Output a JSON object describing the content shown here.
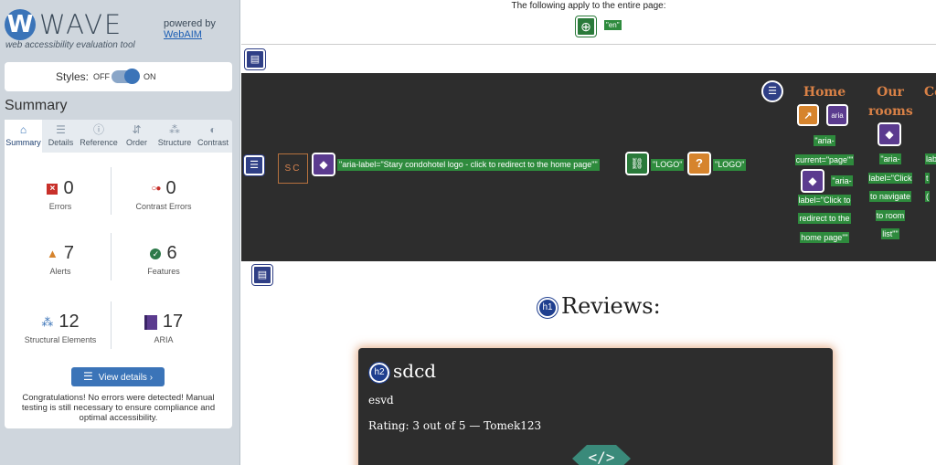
{
  "sidebar": {
    "brand": {
      "badge": "W",
      "name": "WAVE",
      "subtitle": "web accessibility evaluation tool",
      "powered_by": "powered by",
      "webaim_link": "WebAIM"
    },
    "styles": {
      "label": "Styles:",
      "off": "OFF",
      "on": "ON",
      "state": "on"
    },
    "summary_title": "Summary",
    "tabs": [
      {
        "label": "Summary",
        "icon": "home-icon",
        "glyph": "⌂",
        "active": true
      },
      {
        "label": "Details",
        "icon": "list-icon",
        "glyph": "☰",
        "active": false
      },
      {
        "label": "Reference",
        "icon": "info-icon",
        "glyph": "ⓘ",
        "active": false
      },
      {
        "label": "Order",
        "icon": "order-icon",
        "glyph": "⇵",
        "active": false
      },
      {
        "label": "Structure",
        "icon": "structure-icon",
        "glyph": "⁂",
        "active": false
      },
      {
        "label": "Contrast",
        "icon": "contrast-icon",
        "glyph": "◐",
        "active": false
      }
    ],
    "stats": [
      {
        "count": "0",
        "label": "Errors",
        "icon": "error-icon"
      },
      {
        "count": "0",
        "label": "Contrast Errors",
        "icon": "contrast-error-icon"
      },
      {
        "count": "7",
        "label": "Alerts",
        "icon": "alert-icon"
      },
      {
        "count": "6",
        "label": "Features",
        "icon": "feature-icon"
      },
      {
        "count": "12",
        "label": "Structural Elements",
        "icon": "structure-icon"
      },
      {
        "count": "17",
        "label": "ARIA",
        "icon": "aria-icon"
      }
    ],
    "view_details": "View details ›",
    "congrats": "Congratulations! No errors were detected! Manual testing is still necessary to ensure compliance and optimal accessibility."
  },
  "content": {
    "page_note": "The following apply to the entire page:",
    "lang_tag": "\"en\"",
    "header": {
      "logo_text": "SC",
      "logo_aria": "\"aria-label=\"Stary condohotel logo - click to redirect to the home page\"\"",
      "link_tag": "\"LOGO\"",
      "alert_tag": "\"LOGO\"",
      "nav_home": "Home",
      "nav_rooms_1": "Our",
      "nav_rooms_2": "rooms",
      "nav_partial": "Co",
      "aria_label": "aria",
      "home_current": [
        "\"aria-",
        "current=\"page\"\""
      ],
      "home_label": [
        "\"aria-",
        "label=\"Click to",
        "redirect to the",
        "home page\"\""
      ],
      "rooms_label": [
        "\"aria-",
        "label=\"Click",
        "to navigate",
        "to room",
        "list\"\""
      ],
      "partial_tags": [
        "lab",
        "t",
        "("
      ]
    },
    "reviews_heading": "Reviews:",
    "h1_badge": "h1",
    "card": {
      "h2_badge": "h2",
      "title": "sdcd",
      "body": "esvd",
      "rating": "Rating: 3 out of 5 — Tomek123",
      "code_glyph": "</>"
    }
  },
  "colors": {
    "wave_blue": "#3b74b8",
    "feature_green": "#2e8b3d",
    "alert_orange": "#d6842d",
    "aria_purple": "#5b3b8f",
    "structure_navy": "#2f3f86",
    "nav_orange": "#d98146"
  }
}
